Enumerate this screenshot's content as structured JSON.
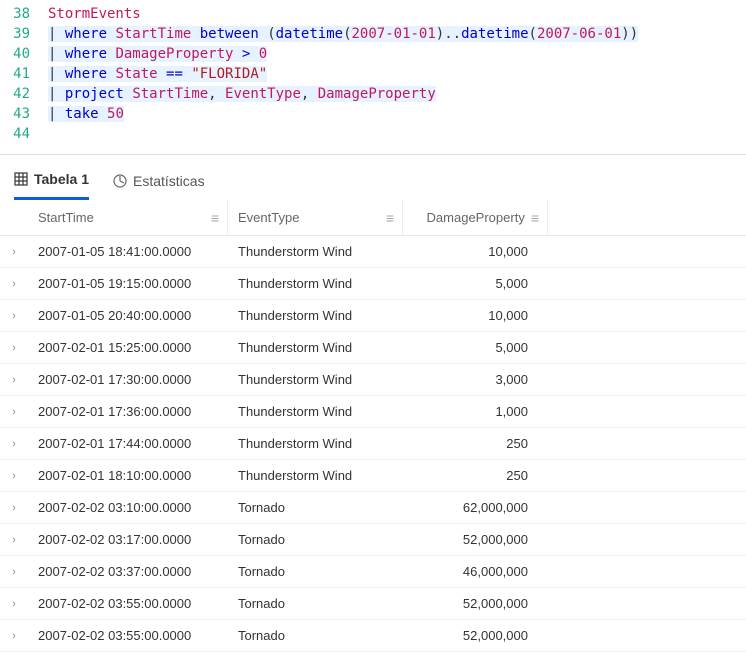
{
  "editor": {
    "lines": [
      {
        "num": "38",
        "hl": false,
        "tokens": [
          {
            "t": "StormEvents",
            "c": "tok-table"
          }
        ]
      },
      {
        "num": "39",
        "hl": true,
        "tokens": [
          {
            "t": "| ",
            "c": "tok-pun"
          },
          {
            "t": "where",
            "c": "tok-kw"
          },
          {
            "t": " ",
            "c": ""
          },
          {
            "t": "StartTime",
            "c": "tok-col"
          },
          {
            "t": " ",
            "c": ""
          },
          {
            "t": "between",
            "c": "tok-kw"
          },
          {
            "t": " (",
            "c": "tok-pun"
          },
          {
            "t": "datetime",
            "c": "tok-fn"
          },
          {
            "t": "(",
            "c": "tok-pun"
          },
          {
            "t": "2007-01-01",
            "c": "tok-num"
          },
          {
            "t": ")..",
            "c": "tok-pun"
          },
          {
            "t": "datetime",
            "c": "tok-fn"
          },
          {
            "t": "(",
            "c": "tok-pun"
          },
          {
            "t": "2007-06-01",
            "c": "tok-num"
          },
          {
            "t": "))",
            "c": "tok-pun"
          }
        ]
      },
      {
        "num": "40",
        "hl": true,
        "tokens": [
          {
            "t": "| ",
            "c": "tok-pun"
          },
          {
            "t": "where",
            "c": "tok-kw"
          },
          {
            "t": " ",
            "c": ""
          },
          {
            "t": "DamageProperty",
            "c": "tok-col"
          },
          {
            "t": " > ",
            "c": "tok-op"
          },
          {
            "t": "0",
            "c": "tok-num"
          }
        ]
      },
      {
        "num": "41",
        "hl": true,
        "tokens": [
          {
            "t": "| ",
            "c": "tok-pun"
          },
          {
            "t": "where",
            "c": "tok-kw"
          },
          {
            "t": " ",
            "c": ""
          },
          {
            "t": "State",
            "c": "tok-col"
          },
          {
            "t": " == ",
            "c": "tok-op"
          },
          {
            "t": "\"FLORIDA\"",
            "c": "tok-str"
          }
        ]
      },
      {
        "num": "42",
        "hl": true,
        "tokens": [
          {
            "t": "| ",
            "c": "tok-pun"
          },
          {
            "t": "project",
            "c": "tok-kw"
          },
          {
            "t": " ",
            "c": ""
          },
          {
            "t": "StartTime",
            "c": "tok-col"
          },
          {
            "t": ", ",
            "c": "tok-pun"
          },
          {
            "t": "EventType",
            "c": "tok-col"
          },
          {
            "t": ", ",
            "c": "tok-pun"
          },
          {
            "t": "DamageProperty",
            "c": "tok-col"
          }
        ]
      },
      {
        "num": "43",
        "hl": true,
        "tokens": [
          {
            "t": "| ",
            "c": "tok-pun"
          },
          {
            "t": "take",
            "c": "tok-kw"
          },
          {
            "t": " ",
            "c": ""
          },
          {
            "t": "50",
            "c": "tok-num"
          }
        ]
      },
      {
        "num": "44",
        "hl": false,
        "tokens": []
      }
    ]
  },
  "tabs": {
    "active": "Tabela 1",
    "inactive": "Estatísticas"
  },
  "grid": {
    "headers": {
      "start": "StartTime",
      "event": "EventType",
      "damage": "DamageProperty"
    },
    "rows": [
      {
        "start": "2007-01-05 18:41:00.0000",
        "event": "Thunderstorm Wind",
        "damage": "10,000"
      },
      {
        "start": "2007-01-05 19:15:00.0000",
        "event": "Thunderstorm Wind",
        "damage": "5,000"
      },
      {
        "start": "2007-01-05 20:40:00.0000",
        "event": "Thunderstorm Wind",
        "damage": "10,000"
      },
      {
        "start": "2007-02-01 15:25:00.0000",
        "event": "Thunderstorm Wind",
        "damage": "5,000"
      },
      {
        "start": "2007-02-01 17:30:00.0000",
        "event": "Thunderstorm Wind",
        "damage": "3,000"
      },
      {
        "start": "2007-02-01 17:36:00.0000",
        "event": "Thunderstorm Wind",
        "damage": "1,000"
      },
      {
        "start": "2007-02-01 17:44:00.0000",
        "event": "Thunderstorm Wind",
        "damage": "250"
      },
      {
        "start": "2007-02-01 18:10:00.0000",
        "event": "Thunderstorm Wind",
        "damage": "250"
      },
      {
        "start": "2007-02-02 03:10:00.0000",
        "event": "Tornado",
        "damage": "62,000,000"
      },
      {
        "start": "2007-02-02 03:17:00.0000",
        "event": "Tornado",
        "damage": "52,000,000"
      },
      {
        "start": "2007-02-02 03:37:00.0000",
        "event": "Tornado",
        "damage": "46,000,000"
      },
      {
        "start": "2007-02-02 03:55:00.0000",
        "event": "Tornado",
        "damage": "52,000,000"
      },
      {
        "start": "2007-02-02 03:55:00.0000",
        "event": "Tornado",
        "damage": "52,000,000"
      }
    ]
  },
  "icons": {
    "menu_glyph": "≡",
    "chevron_glyph": "›"
  }
}
